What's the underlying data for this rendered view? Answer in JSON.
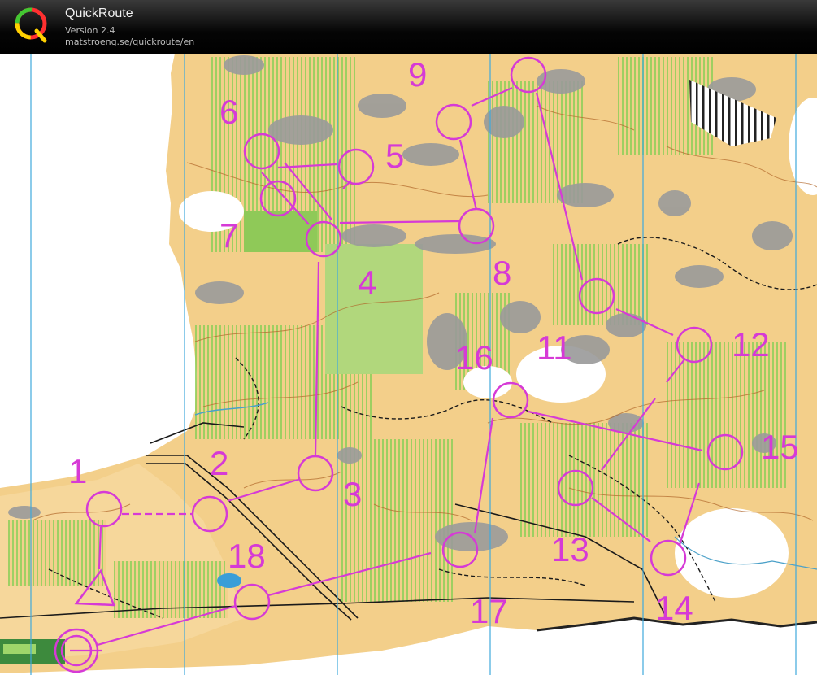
{
  "app": {
    "title": "QuickRoute",
    "version": "Version 2.4",
    "url": "matstroeng.se/quickroute/en"
  },
  "course": {
    "color": "#d63ad6",
    "start_label": "",
    "controls": [
      {
        "number": "1"
      },
      {
        "number": "2"
      },
      {
        "number": "3"
      },
      {
        "number": "4"
      },
      {
        "number": "5"
      },
      {
        "number": "6"
      },
      {
        "number": "7"
      },
      {
        "number": "8"
      },
      {
        "number": "9"
      },
      {
        "number": "11"
      },
      {
        "number": "12"
      },
      {
        "number": "13"
      },
      {
        "number": "14"
      },
      {
        "number": "15"
      },
      {
        "number": "16"
      },
      {
        "number": "17"
      },
      {
        "number": "18"
      }
    ]
  },
  "map_colors": {
    "open_land": "#f3cf8a",
    "forest": "#ffffff",
    "green": "#9fd66a",
    "rock": "#9a9a9a",
    "contour": "#b0662a",
    "grid_line": "#3fa9dd",
    "marsh": "#4aa0c8"
  }
}
